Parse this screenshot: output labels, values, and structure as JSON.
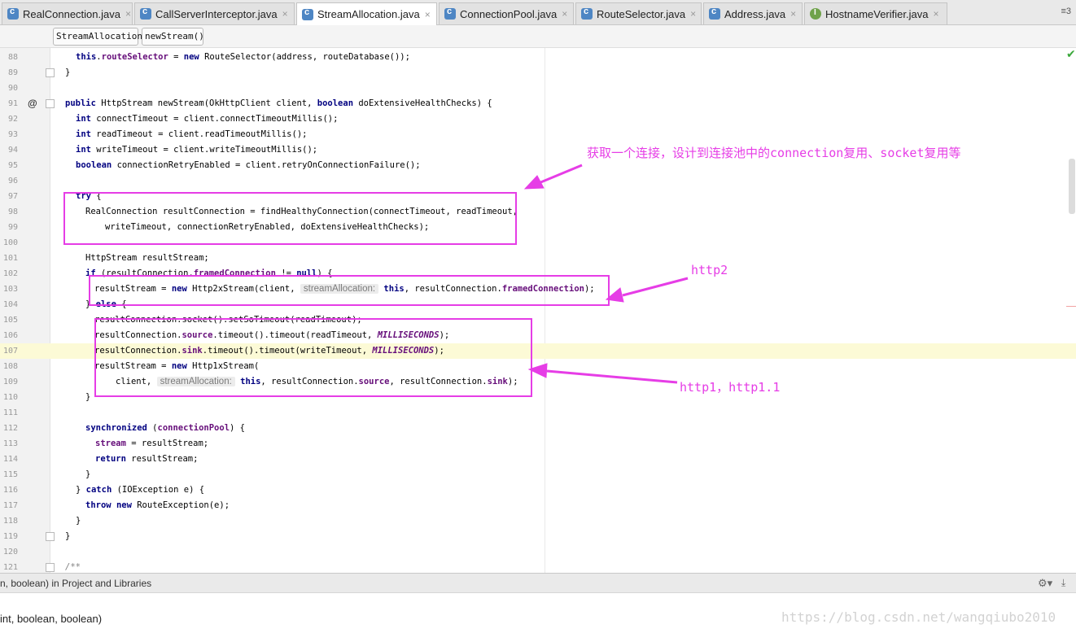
{
  "tabs": [
    {
      "label": "RealConnection.java",
      "icon": "class-icon"
    },
    {
      "label": "CallServerInterceptor.java",
      "icon": "class-icon"
    },
    {
      "label": "StreamAllocation.java",
      "icon": "class-icon",
      "active": true
    },
    {
      "label": "ConnectionPool.java",
      "icon": "class-icon"
    },
    {
      "label": "RouteSelector.java",
      "icon": "class-icon"
    },
    {
      "label": "Address.java",
      "icon": "class-icon"
    },
    {
      "label": "HostnameVerifier.java",
      "icon": "interface-icon"
    }
  ],
  "tab_close": "×",
  "tab_overflow": "≡3",
  "breadcrumb": [
    "StreamAllocation",
    "newStream()"
  ],
  "lines": {
    "l88": "88",
    "l89": "89",
    "l90": "90",
    "l91": "91",
    "l92": "92",
    "l93": "93",
    "l94": "94",
    "l95": "95",
    "l96": "96",
    "l97": "97",
    "l98": "98",
    "l99": "99",
    "l100": "100",
    "l101": "101",
    "l102": "102",
    "l103": "103",
    "l104": "104",
    "l105": "105",
    "l106": "106",
    "l107": "107",
    "l108": "108",
    "l109": "109",
    "l110": "110",
    "l111": "111",
    "l112": "112",
    "l113": "113",
    "l114": "114",
    "l115": "115",
    "l116": "116",
    "l117": "117",
    "l118": "118",
    "l119": "119",
    "l120": "120",
    "l121": "121"
  },
  "code": {
    "c88_a": "this",
    "c88_b": ".",
    "c88_c": "routeSelector",
    "c88_d": " = ",
    "c88_e": "new",
    "c88_f": " RouteSelector(address, routeDatabase());",
    "c89": "}",
    "c91_a": "public",
    "c91_b": " HttpStream newStream(OkHttpClient client, ",
    "c91_c": "boolean",
    "c91_d": " doExtensiveHealthChecks) {",
    "c92_a": "int",
    "c92_b": " connectTimeout = client.connectTimeoutMillis();",
    "c93_a": "int",
    "c93_b": " readTimeout = client.readTimeoutMillis();",
    "c94_a": "int",
    "c94_b": " writeTimeout = client.writeTimeoutMillis();",
    "c95_a": "boolean",
    "c95_b": " connectionRetryEnabled = client.retryOnConnectionFailure();",
    "c97_a": "try",
    "c97_b": " {",
    "c98": "RealConnection resultConnection = findHealthyConnection(connectTimeout, readTimeout,",
    "c99": "writeTimeout, connectionRetryEnabled, doExtensiveHealthChecks);",
    "c101": "HttpStream resultStream;",
    "c102_a": "if",
    "c102_b": " (resultConnection.",
    "c102_c": "framedConnection",
    "c102_d": " != ",
    "c102_e": "null",
    "c102_f": ") {",
    "c103_a": "resultStream = ",
    "c103_b": "new",
    "c103_c": " Http2xStream(client, ",
    "c103_hint": "streamAllocation:",
    "c103_d": "this",
    "c103_e": ", resultConnection.",
    "c103_f": "framedConnection",
    "c103_g": ");",
    "c104_a": "} ",
    "c104_b": "else",
    "c104_c": " {",
    "c105": "resultConnection.socket().setSoTimeout(readTimeout);",
    "c106_a": "resultConnection.",
    "c106_b": "source",
    "c106_c": ".timeout().timeout(readTimeout, ",
    "c106_d": "MILLISECONDS",
    "c106_e": ");",
    "c107_a": "resultConnection.",
    "c107_b": "sink",
    "c107_c": ".timeout().timeout(writeTimeout, ",
    "c107_d": "MILLISECONDS",
    "c107_e": ");",
    "c108_a": "resultStream = ",
    "c108_b": "new",
    "c108_c": " Http1xStream(",
    "c109_a": "client, ",
    "c109_hint": "streamAllocation:",
    "c109_b": "this",
    "c109_c": ", resultConnection.",
    "c109_d": "source",
    "c109_e": ", resultConnection.",
    "c109_f": "sink",
    "c109_g": ");",
    "c110": "}",
    "c112_a": "synchronized",
    "c112_b": " (",
    "c112_c": "connectionPool",
    "c112_d": ") {",
    "c113_a": "stream",
    "c113_b": " = resultStream;",
    "c114_a": "return",
    "c114_b": " resultStream;",
    "c115": "}",
    "c116_a": "} ",
    "c116_b": "catch",
    "c116_c": " (IOException e) {",
    "c117_a": "throw",
    "c117_b": " ",
    "c117_c": "new",
    "c117_d": " RouteException(e);",
    "c118": "}",
    "c119": "}",
    "c121": "/**"
  },
  "annotations": {
    "connection": "获取一个连接，设计到连接池中的connection复用、socket复用等",
    "http2": "http2",
    "http1": "http1，http1.1"
  },
  "annotation_color": "#e63de6",
  "status": {
    "line1": "n, boolean) in Project and Libraries",
    "line2": "int, boolean, boolean)"
  },
  "watermark": "https://blog.csdn.net/wangqiubo2010",
  "colors": {
    "keyword": "#000080",
    "field": "#660e7a",
    "highlight_line": "#fcfad6"
  }
}
